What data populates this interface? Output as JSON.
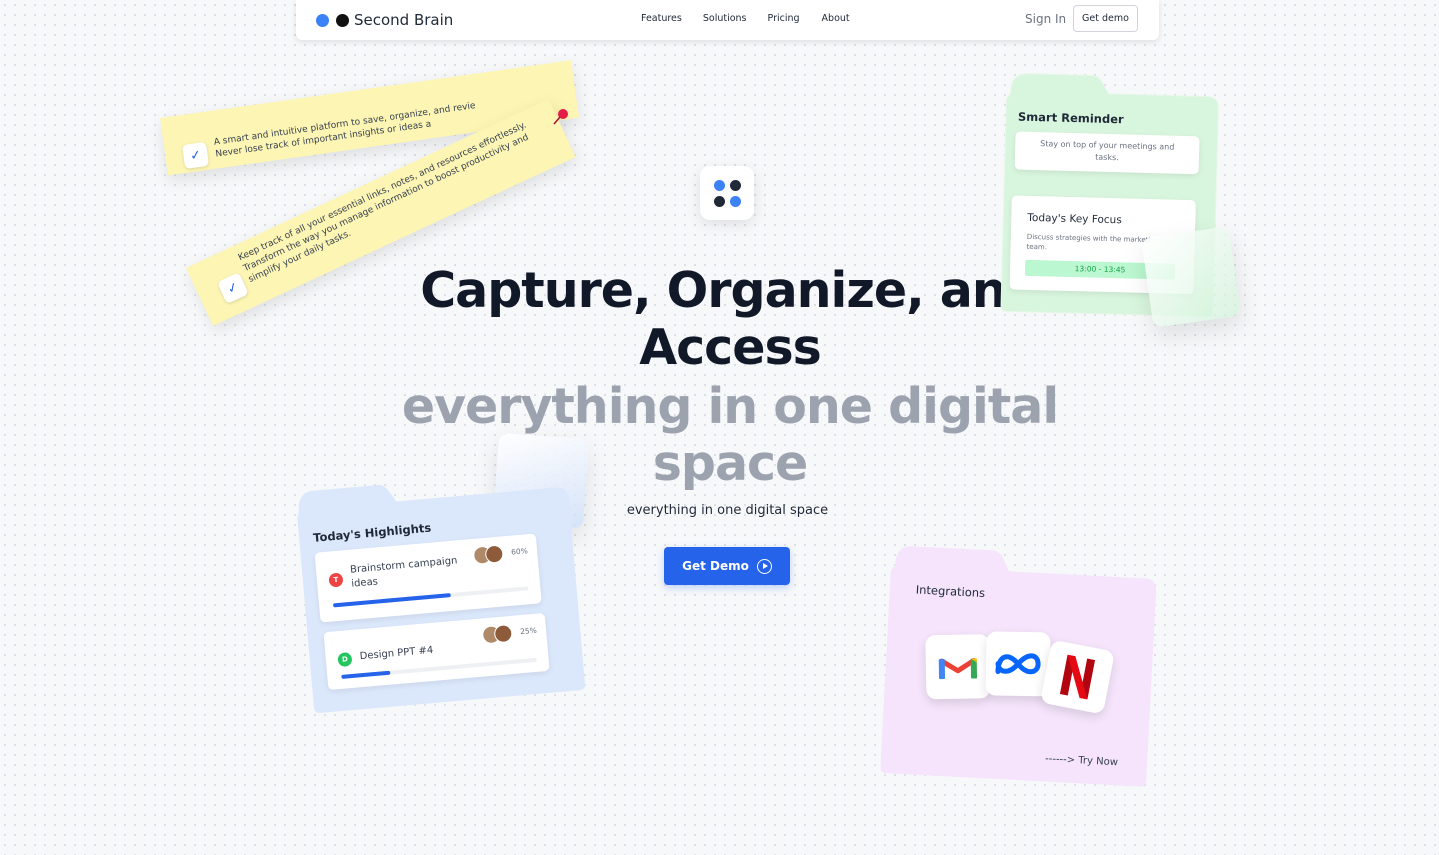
{
  "nav": {
    "brand": "Second Brain",
    "links": [
      "Features",
      "Solutions",
      "Pricing",
      "About"
    ],
    "sign_in": "Sign In",
    "get_demo": "Get demo"
  },
  "hero": {
    "title_line1": "Capture, Organize, and",
    "title_line2": "Access",
    "title_gray_line1": "everything in one digital",
    "title_gray_line2": "space",
    "subtitle": "everything in one digital space",
    "cta": "Get Demo"
  },
  "sticky_notes": {
    "note1_line1": "A smart and intuitive platform to save, organize, and revie",
    "note1_line2": "Never lose track of important insights or ideas a",
    "note2_line1": "Keep track of all your essential links, notes, and resources effortlessly.",
    "note2_line2": "Transform the way you manage information to boost productivity and",
    "note2_line3": "simplify your daily tasks."
  },
  "smart_reminder": {
    "title": "Smart Reminder",
    "message": "Stay on top of your meetings and tasks.",
    "focus_title": "Today's Key Focus",
    "focus_desc": "Discuss strategies with the marketi team.",
    "time": "13:00 - 13:45"
  },
  "highlights": {
    "title": "Today's Highlights",
    "items": [
      {
        "initial": "T",
        "label_line1": "Brainstorm campaign",
        "label_line2": "ideas",
        "percent": "60%",
        "progress": 0.6,
        "color": "#ef4444"
      },
      {
        "initial": "D",
        "label_line1": "Design PPT #4",
        "label_line2": "",
        "percent": "25%",
        "progress": 0.25,
        "color": "#22c55e"
      }
    ]
  },
  "integrations": {
    "title": "Integrations",
    "apps": [
      "gmail-icon",
      "meta-icon",
      "netflix-icon"
    ],
    "try_now": "------> Try Now"
  },
  "colors": {
    "primary": "#2563eb",
    "sticky": "#fdf5b3",
    "reminder_bg": "#d8f5dd",
    "highlights_bg": "#dbe7fb",
    "integrations_bg": "#f5e4fb"
  }
}
